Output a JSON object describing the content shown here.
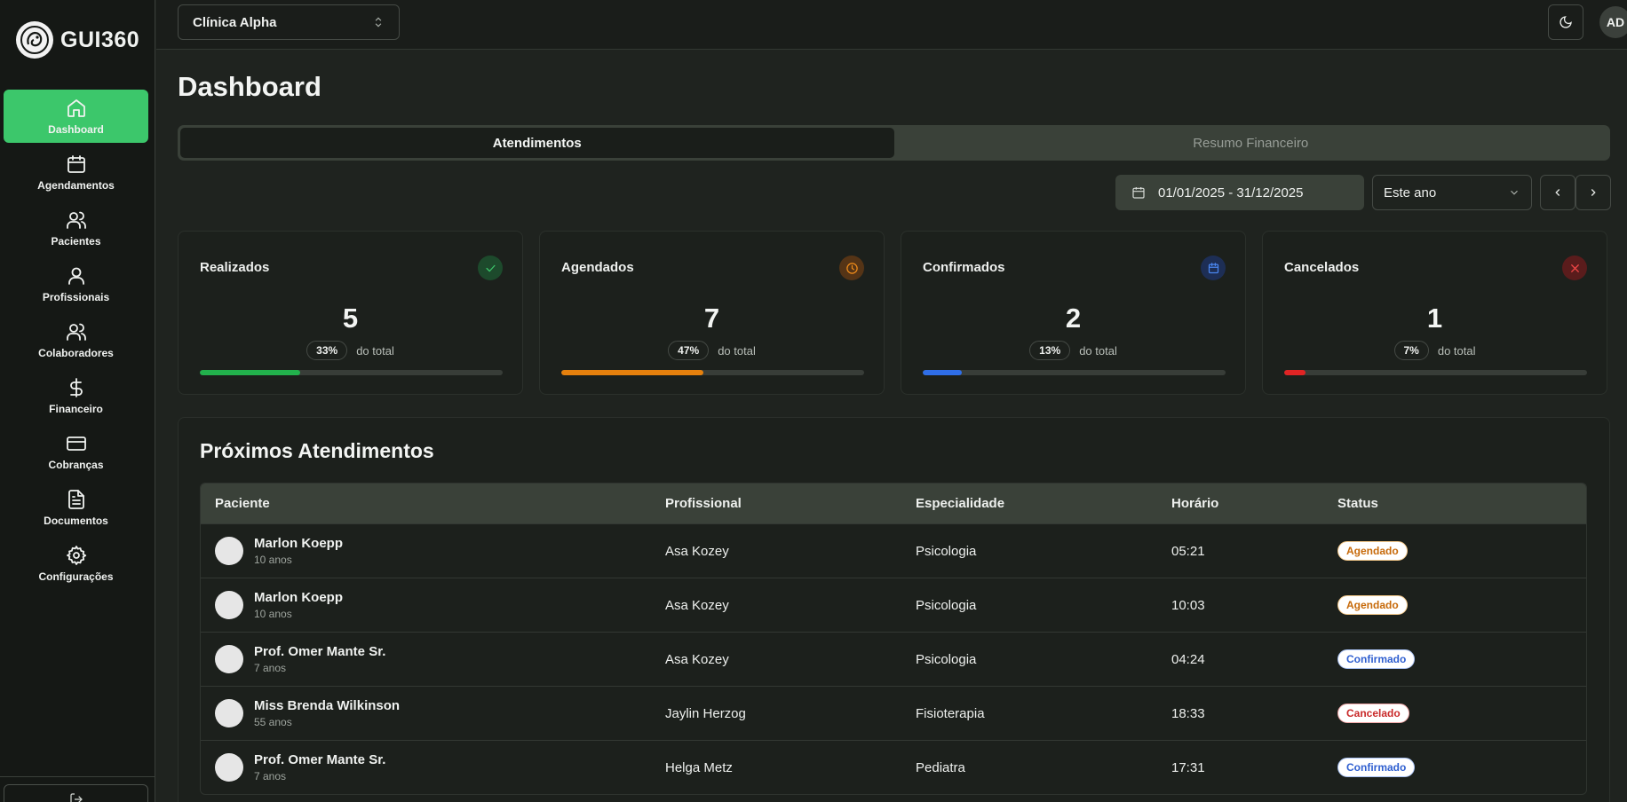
{
  "sidebar": {
    "logo_text": "GUI360",
    "items": [
      {
        "label": "Dashboard",
        "icon": "home-icon",
        "active": true
      },
      {
        "label": "Agendamentos",
        "icon": "calendar-icon",
        "active": false
      },
      {
        "label": "Pacientes",
        "icon": "users-icon",
        "active": false
      },
      {
        "label": "Profissionais",
        "icon": "user-icon",
        "active": false
      },
      {
        "label": "Colaboradores",
        "icon": "users-icon",
        "active": false
      },
      {
        "label": "Financeiro",
        "icon": "dollar-icon",
        "active": false
      },
      {
        "label": "Cobranças",
        "icon": "credit-card-icon",
        "active": false
      },
      {
        "label": "Documentos",
        "icon": "file-icon",
        "active": false
      },
      {
        "label": "Configurações",
        "icon": "gear-icon",
        "active": false
      }
    ]
  },
  "header": {
    "clinic": "Clínica Alpha",
    "avatar_initials": "AD"
  },
  "main": {
    "title": "Dashboard",
    "tabs": [
      {
        "label": "Atendimentos",
        "active": true
      },
      {
        "label": "Resumo Financeiro",
        "active": false
      }
    ],
    "date_range": "01/01/2025 - 31/12/2025",
    "period": "Este ano"
  },
  "stats": [
    {
      "title": "Realizados",
      "value": "5",
      "pct": "33%",
      "pct_label": "do total",
      "fraction": 0.33,
      "color": "#22b14c",
      "icon": "check-icon",
      "icon_bg": "#1d4a2c"
    },
    {
      "title": "Agendados",
      "value": "7",
      "pct": "47%",
      "pct_label": "do total",
      "fraction": 0.47,
      "color": "#e5800d",
      "icon": "clock-icon",
      "icon_bg": "#553416"
    },
    {
      "title": "Confirmados",
      "value": "2",
      "pct": "13%",
      "pct_label": "do total",
      "fraction": 0.13,
      "color": "#2f6ee8",
      "icon": "calendar-icon",
      "icon_bg": "#1d2e55"
    },
    {
      "title": "Cancelados",
      "value": "1",
      "pct": "7%",
      "pct_label": "do total",
      "fraction": 0.07,
      "color": "#e02424",
      "icon": "x-icon",
      "icon_bg": "#5a1c1c"
    }
  ],
  "appointments": {
    "title": "Próximos Atendimentos",
    "columns": [
      "Paciente",
      "Profissional",
      "Especialidade",
      "Horário",
      "Status"
    ],
    "rows": [
      {
        "patient": "Marlon Koepp",
        "age": "10 anos",
        "professional": "Asa Kozey",
        "specialty": "Psicologia",
        "time": "05:21",
        "status": "Agendado",
        "status_color": "#c76a0a",
        "status_border": "#f4c98a"
      },
      {
        "patient": "Marlon Koepp",
        "age": "10 anos",
        "professional": "Asa Kozey",
        "specialty": "Psicologia",
        "time": "10:03",
        "status": "Agendado",
        "status_color": "#c76a0a",
        "status_border": "#f4c98a"
      },
      {
        "patient": "Prof. Omer Mante Sr.",
        "age": "7 anos",
        "professional": "Asa Kozey",
        "specialty": "Psicologia",
        "time": "04:24",
        "status": "Confirmado",
        "status_color": "#2f5fd0",
        "status_border": "#a9c2f4"
      },
      {
        "patient": "Miss Brenda Wilkinson",
        "age": "55 anos",
        "professional": "Jaylin Herzog",
        "specialty": "Fisioterapia",
        "time": "18:33",
        "status": "Cancelado",
        "status_color": "#c92a2a",
        "status_border": "#f2a8a8"
      },
      {
        "patient": "Prof. Omer Mante Sr.",
        "age": "7 anos",
        "professional": "Helga Metz",
        "specialty": "Pediatra",
        "time": "17:31",
        "status": "Confirmado",
        "status_color": "#2f5fd0",
        "status_border": "#a9c2f4"
      }
    ]
  }
}
